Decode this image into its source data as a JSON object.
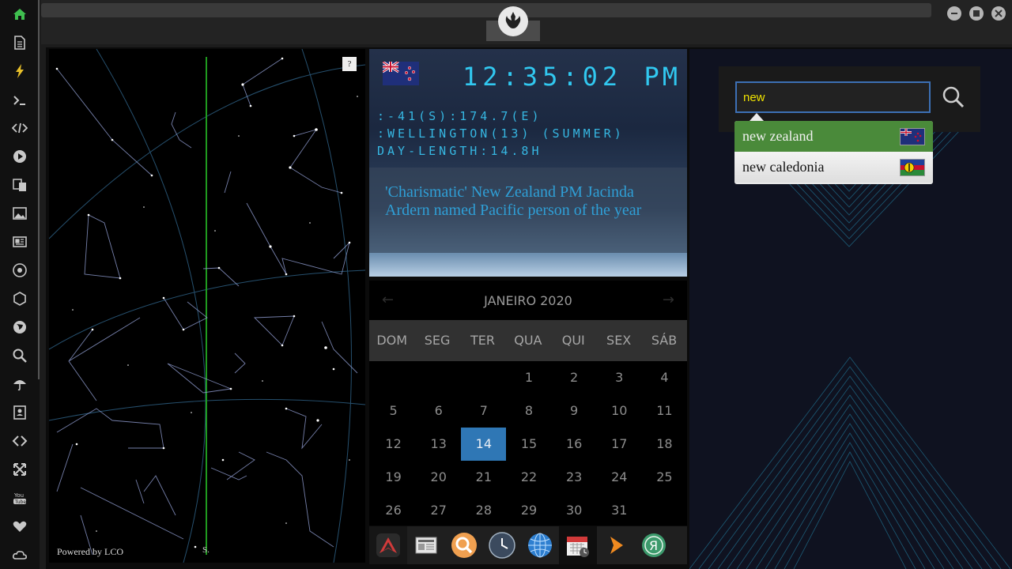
{
  "clock": {
    "time": "12:35:02",
    "ampm": "PM",
    "coords": ":-41(S):174.7(E)",
    "location": ":WELLINGTON(13) (SUMMER)",
    "day_length": "DAY-LENGTH:14.8H",
    "flag": "new-zealand-flag"
  },
  "news": {
    "headline": "'Charismatic' New Zealand PM Jacinda Ardern named Pacific person of the year"
  },
  "starmap": {
    "help_label": "?",
    "powered_by": "Powered by LCO",
    "south_marker": "S."
  },
  "calendar": {
    "month_label": "JANEIRO 2020",
    "prev_label": "←",
    "next_label": "→",
    "weekdays": [
      "DOM",
      "SEG",
      "TER",
      "QUA",
      "QUI",
      "SEX",
      "SÁB"
    ],
    "weeks": [
      [
        "",
        "",
        "",
        "1",
        "2",
        "3",
        "4"
      ],
      [
        "5",
        "6",
        "7",
        "8",
        "9",
        "10",
        "11"
      ],
      [
        "12",
        "13",
        "14",
        "15",
        "16",
        "17",
        "18"
      ],
      [
        "19",
        "20",
        "21",
        "22",
        "23",
        "24",
        "25"
      ],
      [
        "26",
        "27",
        "28",
        "29",
        "30",
        "31",
        ""
      ]
    ],
    "selected_day": "14"
  },
  "search": {
    "value": "new",
    "suggestions": [
      {
        "label": "new zealand",
        "flag": "new-zealand-flag"
      },
      {
        "label": "new caledonia",
        "flag": "new-caledonia-flag"
      }
    ]
  },
  "dock_apps": [
    "airline-icon",
    "news-icon",
    "search-icon",
    "clock-icon",
    "globe-icon",
    "calendar-icon",
    "play-icon",
    "yandex-icon"
  ],
  "sidebar_icons": [
    "home-icon",
    "document-icon",
    "lightning-icon",
    "terminal-icon",
    "code-icon",
    "play-icon",
    "translate-icon",
    "image-icon",
    "newspaper-icon",
    "rebel-icon",
    "hexagon-icon",
    "globe-icon",
    "search-icon",
    "umbrella-icon",
    "contact-icon",
    "link-icon",
    "expand-icon",
    "youtube-icon",
    "heart-icon",
    "cloud-icon"
  ],
  "colors": {
    "accent_blue": "#31c8f0",
    "selected_day": "#2f77b5",
    "suggestion_highlight": "#4a8a3a",
    "search_text": "#f0e300",
    "home_icon": "#3fbf4f"
  }
}
